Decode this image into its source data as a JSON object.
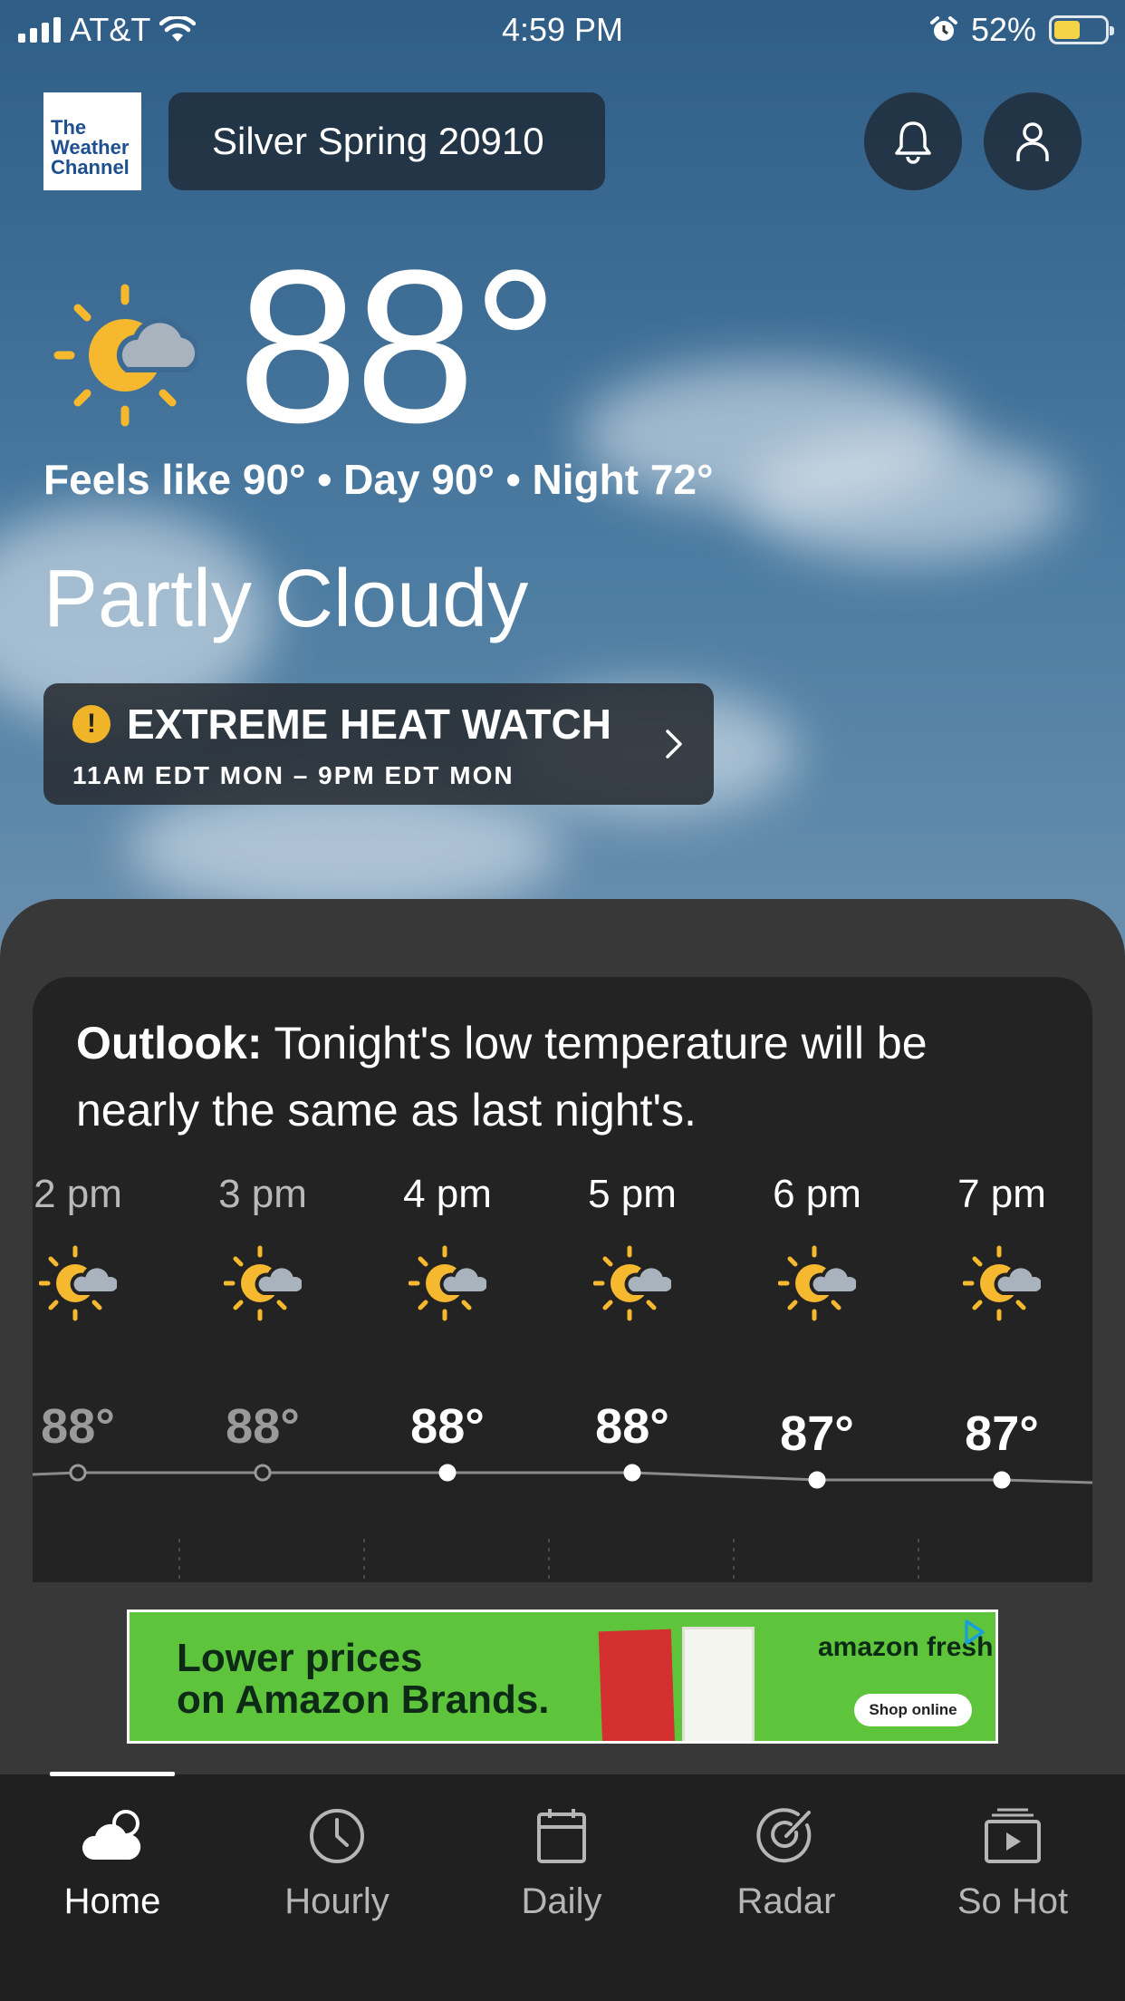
{
  "status_bar": {
    "carrier": "AT&T",
    "time": "4:59 PM",
    "battery": "52%"
  },
  "header": {
    "logo_text": [
      "The",
      "Weather",
      "Channel"
    ],
    "location": "Silver Spring 20910"
  },
  "current": {
    "temperature": "88°",
    "feels_line": "Feels like 90° • Day 90° • Night 72°",
    "phrase": "Partly Cloudy"
  },
  "alert": {
    "title": "EXTREME HEAT WATCH",
    "time_range": "11AM EDT MON – 9PM EDT MON",
    "icon_color": "#f0b429"
  },
  "outlook": {
    "label": "Outlook:",
    "text": " Tonight's low temperature will be nearly the same as last night's."
  },
  "hourly": [
    {
      "time": "2 pm",
      "temp": "88°",
      "value": 88,
      "past": true
    },
    {
      "time": "3 pm",
      "temp": "88°",
      "value": 88,
      "past": true
    },
    {
      "time": "4 pm",
      "temp": "88°",
      "value": 88,
      "past": false
    },
    {
      "time": "5 pm",
      "temp": "88°",
      "value": 88,
      "past": false
    },
    {
      "time": "6 pm",
      "temp": "87°",
      "value": 87,
      "past": false
    },
    {
      "time": "7 pm",
      "temp": "87°",
      "value": 87,
      "past": false
    }
  ],
  "ad": {
    "headline_line1": "Lower prices",
    "headline_line2": "on Amazon Brands.",
    "brand": "amazon fresh",
    "cta": "Shop online"
  },
  "tabs": [
    {
      "label": "Home",
      "icon": "cloud-icon",
      "active": true
    },
    {
      "label": "Hourly",
      "icon": "clock-icon",
      "active": false
    },
    {
      "label": "Daily",
      "icon": "calendar-icon",
      "active": false
    },
    {
      "label": "Radar",
      "icon": "radar-icon",
      "active": false
    },
    {
      "label": "So Hot",
      "icon": "video-icon",
      "active": false
    }
  ],
  "colors": {
    "sun": "#f5b82e",
    "cloud": "#a9b3bd",
    "sheet": "#383838",
    "card": "#232323"
  }
}
